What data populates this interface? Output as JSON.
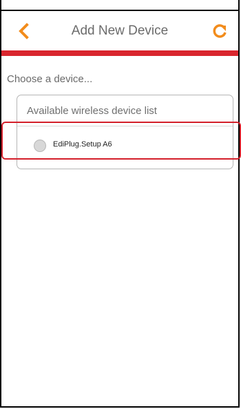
{
  "header": {
    "back_icon": "chevron-left-icon",
    "title": "Add New Device",
    "refresh_icon": "refresh-icon",
    "accent_color": "#f28c1c",
    "bar_color": "#d9262e"
  },
  "main": {
    "choose_label": "Choose a device...",
    "card": {
      "title": "Available wireless device list",
      "devices": [
        {
          "name": "EdiPlug.Setup A6",
          "icon": "device-icon"
        }
      ]
    }
  },
  "annotations": {
    "highlight_color": "#d41f2a"
  }
}
